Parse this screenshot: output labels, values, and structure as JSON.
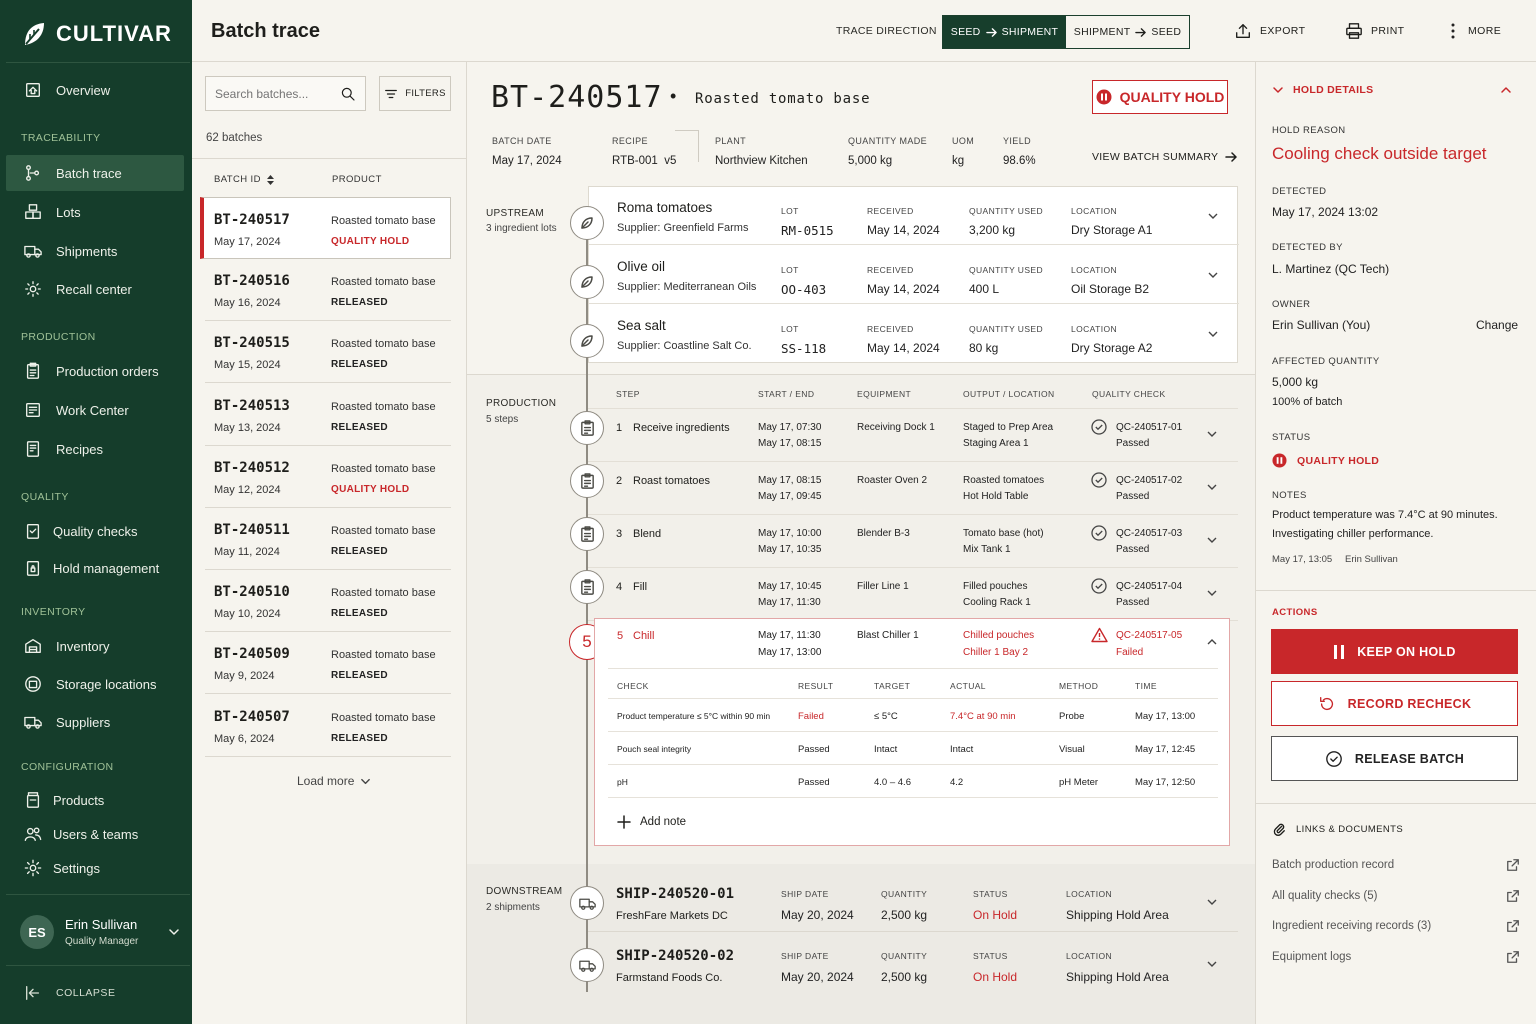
{
  "brand": {
    "name": "CULTIVAR"
  },
  "sidebar": {
    "sections": {
      "traceability": "TRACEABILITY",
      "production": "PRODUCTION",
      "quality": "QUALITY",
      "inventory": "INVENTORY",
      "configuration": "CONFIGURATION"
    },
    "items": {
      "overview": "Overview",
      "batch_trace": "Batch trace",
      "lots": "Lots",
      "shipments": "Shipments",
      "recall_center": "Recall center",
      "production_orders": "Production orders",
      "work_center": "Work Center",
      "recipes": "Recipes",
      "quality_checks": "Quality checks",
      "hold_management": "Hold management",
      "inventory": "Inventory",
      "storage_locations": "Storage locations",
      "suppliers": "Suppliers",
      "products": "Products",
      "users_teams": "Users & teams",
      "settings": "Settings"
    },
    "user": {
      "initials": "ES",
      "name": "Erin Sullivan",
      "role": "Quality Manager"
    },
    "collapse_label": "COLLAPSE"
  },
  "header": {
    "title": "Batch trace",
    "trace_direction_label": "TRACE DIRECTION",
    "dir_a": {
      "from": "SEED",
      "to": "SHIPMENT"
    },
    "dir_b": {
      "from": "SHIPMENT",
      "to": "SEED"
    },
    "export_label": "EXPORT",
    "print_label": "PRINT",
    "more_label": "MORE"
  },
  "list": {
    "search_placeholder": "Search batches...",
    "filters_label": "FILTERS",
    "count": "62 batches",
    "col_batch": "BATCH ID",
    "col_product": "PRODUCT",
    "rows": [
      {
        "id": "BT-240517",
        "date": "May 17, 2024",
        "product": "Roasted tomato base",
        "status": "QUALITY HOLD"
      },
      {
        "id": "BT-240516",
        "date": "May 16, 2024",
        "product": "Roasted tomato base",
        "status": "RELEASED"
      },
      {
        "id": "BT-240515",
        "date": "May 15, 2024",
        "product": "Roasted tomato base",
        "status": "RELEASED"
      },
      {
        "id": "BT-240513",
        "date": "May 13, 2024",
        "product": "Roasted tomato base",
        "status": "RELEASED"
      },
      {
        "id": "BT-240512",
        "date": "May 12, 2024",
        "product": "Roasted tomato base",
        "status": "QUALITY HOLD"
      },
      {
        "id": "BT-240511",
        "date": "May 11, 2024",
        "product": "Roasted tomato base",
        "status": "RELEASED"
      },
      {
        "id": "BT-240510",
        "date": "May 10, 2024",
        "product": "Roasted tomato base",
        "status": "RELEASED"
      },
      {
        "id": "BT-240509",
        "date": "May 9, 2024",
        "product": "Roasted tomato base",
        "status": "RELEASED"
      },
      {
        "id": "BT-240507",
        "date": "May 6, 2024",
        "product": "Roasted tomato base",
        "status": "RELEASED"
      }
    ],
    "load_more": "Load more"
  },
  "batch": {
    "id": "BT-240517",
    "product": "Roasted tomato base",
    "status": "QUALITY HOLD",
    "meta": {
      "batch_date": {
        "label": "BATCH DATE",
        "value": "May 17, 2024"
      },
      "recipe": {
        "label": "RECIPE",
        "value": "RTB-001  v5"
      },
      "plant": {
        "label": "PLANT",
        "value": "Northview Kitchen"
      },
      "quantity": {
        "label": "QUANTITY MADE",
        "value": "5,000 kg"
      },
      "uom": {
        "label": "UOM",
        "value": "kg"
      },
      "yield": {
        "label": "YIELD",
        "value": "98.6%"
      }
    },
    "summary_link": "VIEW BATCH SUMMARY"
  },
  "upstream": {
    "label": "UPSTREAM",
    "sub": "3 ingredient lots",
    "cols": {
      "lot": "LOT",
      "received": "RECEIVED",
      "qty": "QUANTITY USED",
      "location": "LOCATION"
    },
    "items": [
      {
        "name": "Roma tomatoes",
        "supplier": "Supplier: Greenfield Farms",
        "lot": "RM-0515",
        "received": "May 14, 2024",
        "qty": "3,200 kg",
        "location": "Dry Storage A1"
      },
      {
        "name": "Olive oil",
        "supplier": "Supplier: Mediterranean Oils",
        "lot": "OO-403",
        "received": "May 14, 2024",
        "qty": "400 L",
        "location": "Oil Storage B2"
      },
      {
        "name": "Sea salt",
        "supplier": "Supplier: Coastline Salt Co.",
        "lot": "SS-118",
        "received": "May 14, 2024",
        "qty": "80 kg",
        "location": "Dry Storage A2"
      }
    ]
  },
  "production": {
    "label": "PRODUCTION",
    "sub": "5 steps",
    "cols": {
      "step": "STEP",
      "time": "START / END",
      "equipment": "EQUIPMENT",
      "output": "OUTPUT / LOCATION",
      "qc": "QUALITY CHECK"
    },
    "steps": [
      {
        "n": "1",
        "name": "Receive ingredients",
        "start": "May 17, 07:30",
        "end": "May 17, 08:15",
        "equipment": "Receiving Dock 1",
        "out1": "Staged to Prep Area",
        "out2": "Staging Area 1",
        "qc": "QC-240517-01",
        "qcs": "Passed"
      },
      {
        "n": "2",
        "name": "Roast tomatoes",
        "start": "May 17, 08:15",
        "end": "May 17, 09:45",
        "equipment": "Roaster Oven 2",
        "out1": "Roasted tomatoes",
        "out2": "Hot Hold Table",
        "qc": "QC-240517-02",
        "qcs": "Passed"
      },
      {
        "n": "3",
        "name": "Blend",
        "start": "May 17, 10:00",
        "end": "May 17, 10:35",
        "equipment": "Blender B-3",
        "out1": "Tomato base (hot)",
        "out2": "Mix Tank 1",
        "qc": "QC-240517-03",
        "qcs": "Passed"
      },
      {
        "n": "4",
        "name": "Fill",
        "start": "May 17, 10:45",
        "end": "May 17, 11:30",
        "equipment": "Filler Line 1",
        "out1": "Filled pouches",
        "out2": "Cooling Rack 1",
        "qc": "QC-240517-04",
        "qcs": "Passed"
      }
    ],
    "failed": {
      "n": "5",
      "name": "Chill",
      "start": "May 17, 11:30",
      "end": "May 17, 13:00",
      "equipment": "Blast Chiller 1",
      "out1": "Chilled pouches",
      "out2": "Chiller 1 Bay 2",
      "qc": "QC-240517-05",
      "qcs": "Failed"
    },
    "checks_cols": {
      "check": "CHECK",
      "result": "RESULT",
      "target": "TARGET",
      "actual": "ACTUAL",
      "method": "METHOD",
      "time": "TIME"
    },
    "checks": [
      {
        "check": "Product temperature ≤ 5°C within 90 min",
        "result": "Failed",
        "target": "≤ 5°C",
        "actual": "7.4°C at 90 min",
        "method": "Probe",
        "time": "May 17, 13:00"
      },
      {
        "check": "Pouch seal integrity",
        "result": "Passed",
        "target": "Intact",
        "actual": "Intact",
        "method": "Visual",
        "time": "May 17, 12:45"
      },
      {
        "check": "pH",
        "result": "Passed",
        "target": "4.0 – 4.6",
        "actual": "4.2",
        "method": "pH Meter",
        "time": "May 17, 12:50"
      }
    ],
    "add_note": "Add note"
  },
  "downstream": {
    "label": "DOWNSTREAM",
    "sub": "2 shipments",
    "cols": {
      "date": "SHIP DATE",
      "qty": "QUANTITY",
      "status": "STATUS",
      "location": "LOCATION"
    },
    "items": [
      {
        "id": "SHIP-240520-01",
        "customer": "FreshFare Markets DC",
        "date": "May 20, 2024",
        "qty": "2,500 kg",
        "status": "On Hold",
        "location": "Shipping Hold Area"
      },
      {
        "id": "SHIP-240520-02",
        "customer": "Farmstand Foods Co.",
        "date": "May 20, 2024",
        "qty": "2,500 kg",
        "status": "On Hold",
        "location": "Shipping Hold Area"
      }
    ]
  },
  "hold": {
    "title": "HOLD DETAILS",
    "reason_label": "HOLD REASON",
    "reason": "Cooling check outside target",
    "detected_label": "DETECTED",
    "detected": "May 17, 2024 13:02",
    "detected_by_label": "DETECTED BY",
    "detected_by": "L. Martinez (QC Tech)",
    "owner_label": "OWNER",
    "owner": "Erin Sullivan (You)",
    "change": "Change",
    "affected_label": "AFFECTED QUANTITY",
    "affected": "5,000 kg",
    "affected_pct": "100% of batch",
    "status_label": "STATUS",
    "status": "QUALITY HOLD",
    "notes_label": "NOTES",
    "note1": "Product temperature was 7.4°C at 90 minutes.",
    "note2": "Investigating chiller performance.",
    "note_time": "May 17, 13:05",
    "note_author": "Erin Sullivan",
    "actions_label": "ACTIONS",
    "keep": "KEEP ON HOLD",
    "recheck": "RECORD RECHECK",
    "release": "RELEASE BATCH",
    "links_label": "LINKS & DOCUMENTS",
    "docs": [
      "Batch production record",
      "All quality checks (5)",
      "Ingredient receiving records (3)",
      "Equipment logs"
    ]
  },
  "colors": {
    "brand_green": "#153d2b",
    "hold_red": "#c8272a",
    "background": "#f6f4ee"
  }
}
